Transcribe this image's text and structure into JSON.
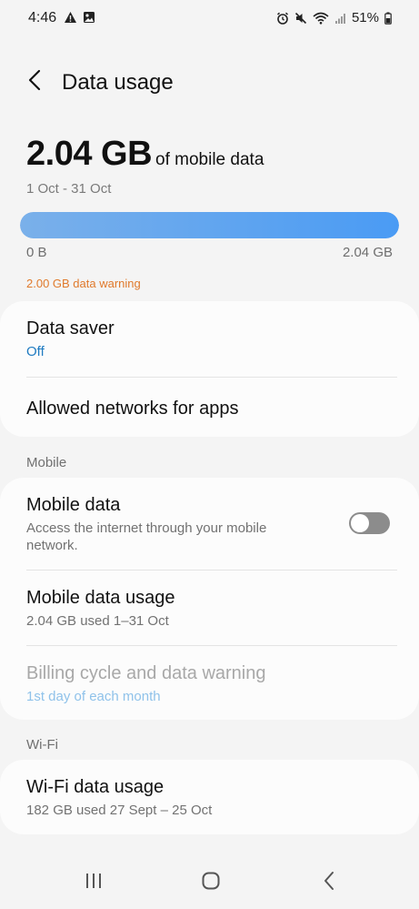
{
  "status_bar": {
    "time": "4:46",
    "battery": "51%",
    "left_icons": [
      "warning-icon",
      "image-icon"
    ],
    "right_icons": [
      "alarm-icon",
      "mute-icon",
      "wifi-icon",
      "signal-icon",
      "battery-icon"
    ]
  },
  "header": {
    "title": "Data usage",
    "back_icon": "back-arrow-icon"
  },
  "usage": {
    "amount": "2.04 GB",
    "suffix": "of mobile data",
    "period": "1 Oct - 31 Oct",
    "bar_min": "0 B",
    "bar_max": "2.04 GB",
    "fill_fraction": 1.0,
    "warning": "2.00 GB data warning"
  },
  "card_saver": {
    "data_saver_title": "Data saver",
    "data_saver_value": "Off",
    "allowed_networks_title": "Allowed networks for apps"
  },
  "section_mobile": "Mobile",
  "card_mobile": {
    "mobile_data_title": "Mobile data",
    "mobile_data_desc": "Access the internet through your mobile network.",
    "mobile_data_enabled": false,
    "usage_title": "Mobile data usage",
    "usage_sub": "2.04 GB used 1–31 Oct",
    "billing_title": "Billing cycle and data warning",
    "billing_sub": "1st day of each month"
  },
  "section_wifi": "Wi-Fi",
  "card_wifi": {
    "usage_title": "Wi-Fi data usage",
    "usage_sub": "182 GB used 27 Sept – 25 Oct"
  },
  "nav": {
    "recents_icon": "recents-icon",
    "home_icon": "home-icon",
    "back_icon": "back-icon"
  },
  "colors": {
    "accent_blue": "#4a9bf4",
    "warning_orange": "#e07a2c",
    "link_blue": "#1f7bc1"
  }
}
